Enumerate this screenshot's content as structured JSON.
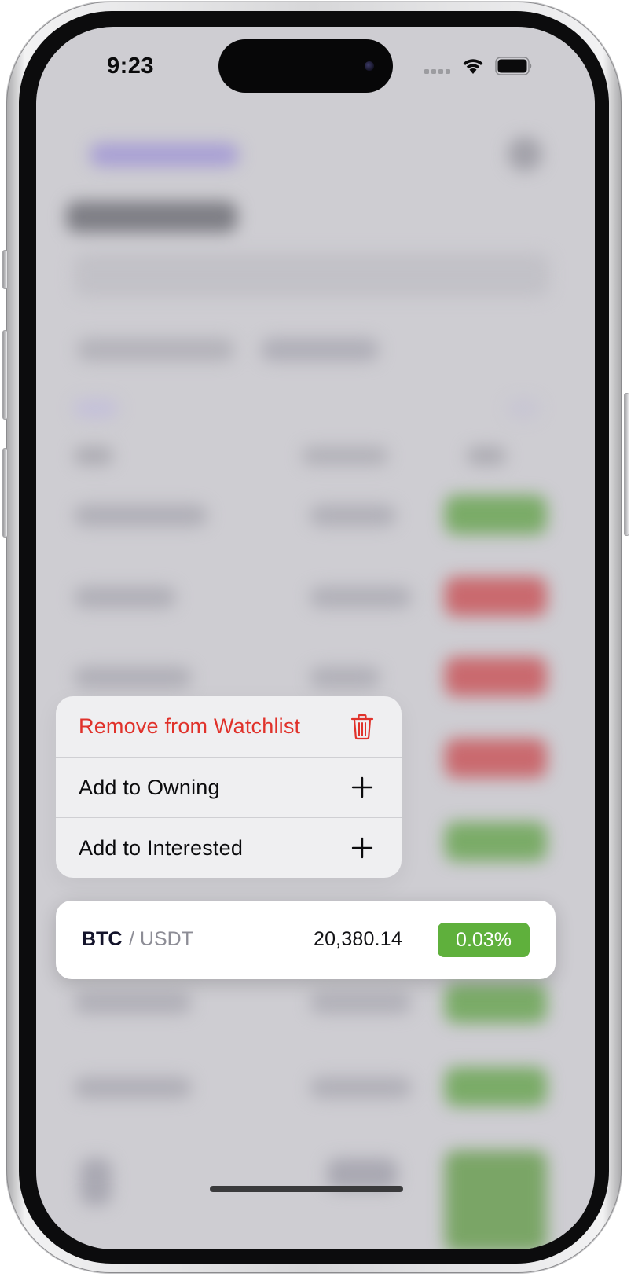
{
  "status_bar": {
    "time": "9:23",
    "signal_icon": "cellular-signal-icon",
    "wifi_icon": "wifi-icon",
    "battery_icon": "battery-icon"
  },
  "context_menu": {
    "items": [
      {
        "label": "Remove from Watchlist",
        "icon": "trash-icon",
        "destructive": true
      },
      {
        "label": "Add to Owning",
        "icon": "plus-icon",
        "destructive": false
      },
      {
        "label": "Add to Interested",
        "icon": "plus-icon",
        "destructive": false
      }
    ]
  },
  "preview_card": {
    "base": "BTC",
    "quote": "/ USDT",
    "price": "20,380.14",
    "change": "0.03%",
    "change_color": "#5fb03c"
  },
  "colors": {
    "destructive": "#e0322b",
    "positive": "#5fb03c",
    "negative": "#d96a6f",
    "accent": "#8e84d6"
  }
}
